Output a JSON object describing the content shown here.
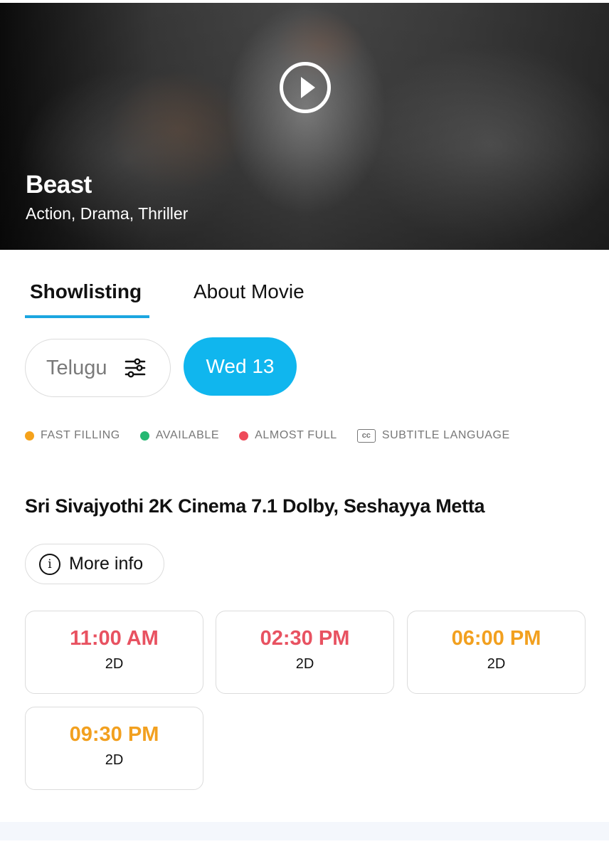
{
  "hero": {
    "title": "Beast",
    "genres": "Action, Drama, Thriller",
    "play_icon": "play-circle-icon"
  },
  "tabs": [
    {
      "label": "Showlisting",
      "active": true
    },
    {
      "label": "About Movie",
      "active": false
    }
  ],
  "filters": {
    "language": "Telugu",
    "language_icon": "sliders-icon",
    "date": "Wed 13"
  },
  "legend": [
    {
      "label": "FAST FILLING",
      "color": "#f5a21b",
      "icon": "dot"
    },
    {
      "label": "AVAILABLE",
      "color": "#25b872",
      "icon": "dot"
    },
    {
      "label": "ALMOST FULL",
      "color": "#ee4b5a",
      "icon": "dot"
    },
    {
      "label": "SUBTITLE LANGUAGE",
      "icon": "cc",
      "icon_text": "cc"
    }
  ],
  "cinema": {
    "name": "Sri Sivajyothi 2K Cinema 7.1 Dolby, Seshayya Metta",
    "more_info_label": "More info",
    "info_glyph": "i",
    "showtimes": [
      {
        "time": "11:00 AM",
        "format": "2D",
        "status": "almost-full",
        "color": "#e85261"
      },
      {
        "time": "02:30 PM",
        "format": "2D",
        "status": "almost-full",
        "color": "#e85261"
      },
      {
        "time": "06:00 PM",
        "format": "2D",
        "status": "fast-filling",
        "color": "#f2a01f"
      },
      {
        "time": "09:30 PM",
        "format": "2D",
        "status": "fast-filling",
        "color": "#f2a01f"
      }
    ]
  },
  "colors": {
    "accent": "#10b6ee",
    "tab_underline": "#1ba6e0"
  }
}
